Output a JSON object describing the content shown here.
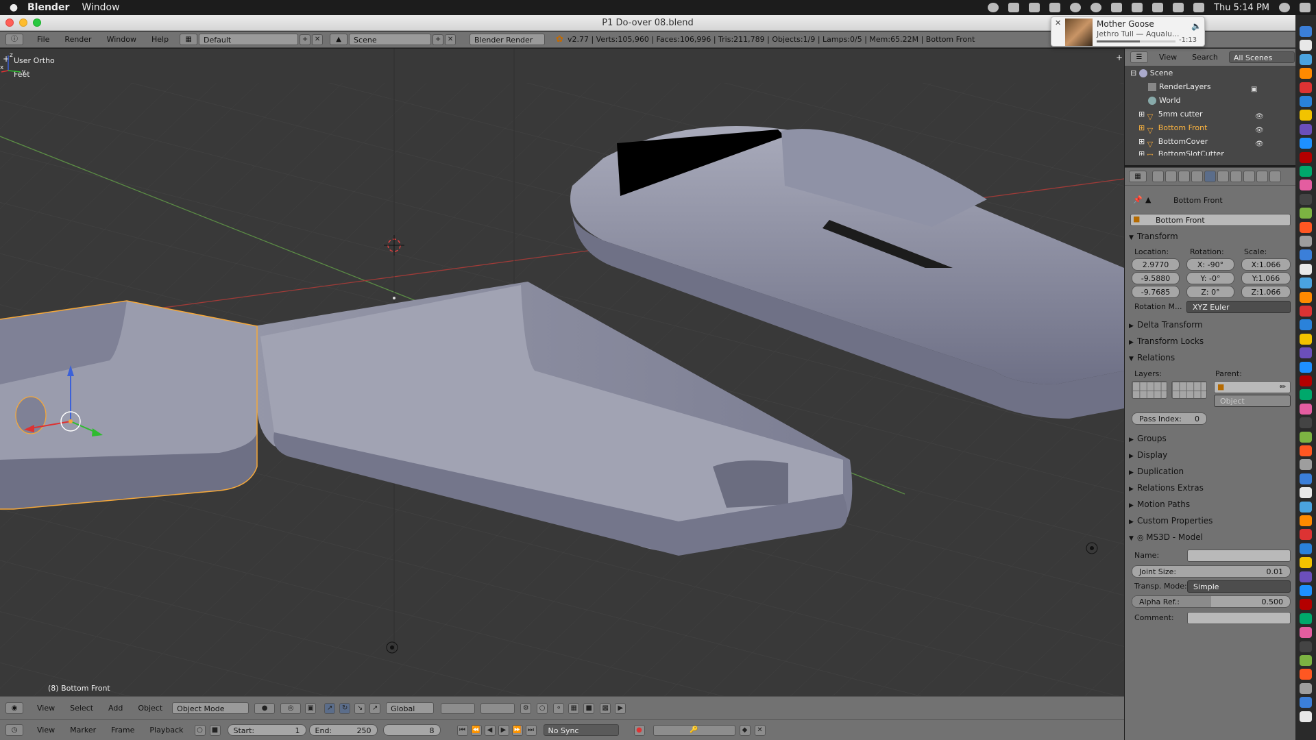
{
  "menubar": {
    "app_name": "Blender",
    "menu_window": "Window",
    "clock": "Thu 5:14 PM"
  },
  "window": {
    "title": "P1 Do-over 08.blend"
  },
  "notification": {
    "title": "Mother Goose",
    "subtitle": "Jethro Tull — Aqualu...",
    "time_remaining": "-1:13",
    "progress": 0.55
  },
  "infobar": {
    "menus": [
      "File",
      "Render",
      "Window",
      "Help"
    ],
    "screen_layout": "Default",
    "scene": "Scene",
    "render_engine": "Blender Render",
    "stats": "v2.77 | Verts:105,960 | Faces:106,996 | Tris:211,789 | Objects:1/9 | Lamps:0/5 | Mem:65.22M | Bottom Front"
  },
  "viewport": {
    "view_name": "User Ortho",
    "units": "Feet",
    "active_object_label": "(8) Bottom Front",
    "axis_x": "x",
    "axis_y": "y",
    "axis_z": "z"
  },
  "viewport_header": {
    "menus": [
      "View",
      "Select",
      "Add",
      "Object"
    ],
    "mode": "Object Mode",
    "orientation": "Global"
  },
  "timeline": {
    "menus": [
      "View",
      "Marker",
      "Frame",
      "Playback"
    ],
    "start_label": "Start:",
    "start_value": "1",
    "end_label": "End:",
    "end_value": "250",
    "current_frame": "8",
    "sync": "No Sync"
  },
  "outliner": {
    "menus": [
      "View",
      "Search"
    ],
    "filter": "All Scenes",
    "items": [
      {
        "label": "Scene"
      },
      {
        "label": "RenderLayers"
      },
      {
        "label": "World"
      },
      {
        "label": "5mm cutter"
      },
      {
        "label": "Bottom Front"
      },
      {
        "label": "BottomCover"
      },
      {
        "label": "BottomSlotCutter"
      }
    ]
  },
  "properties": {
    "breadcrumb": "Bottom Front",
    "object_name": "Bottom Front",
    "transform": {
      "title": "Transform",
      "location_label": "Location:",
      "rotation_label": "Rotation:",
      "scale_label": "Scale:",
      "location": [
        "2.9770",
        "-9.5880",
        "-9.7685"
      ],
      "rotation": [
        "X:  -90°",
        "Y:   -0°",
        "Z:    0°"
      ],
      "scale": [
        "X:1.066",
        "Y:1.066",
        "Z:1.066"
      ],
      "rotation_mode_label": "Rotation M...",
      "rotation_mode": "XYZ Euler"
    },
    "delta_transform": "Delta Transform",
    "transform_locks": "Transform Locks",
    "relations": {
      "title": "Relations",
      "layers_label": "Layers:",
      "parent_label": "Parent:",
      "parent_type": "Object",
      "pass_index_label": "Pass Index:",
      "pass_index": "0"
    },
    "collapsed_panels": [
      "Groups",
      "Display",
      "Duplication",
      "Relations Extras",
      "Motion Paths",
      "Custom Properties"
    ],
    "ms3d": {
      "title": "MS3D - Model",
      "name_label": "Name:",
      "joint_size_label": "Joint Size:",
      "joint_size": "0.01",
      "transp_mode_label": "Transp. Mode:",
      "transp_mode": "Simple",
      "alpha_ref_label": "Alpha Ref.:",
      "alpha_ref": "0.500",
      "alpha_ref_value": 0.5,
      "comment_label": "Comment:"
    }
  },
  "colors": {
    "viewport_bg": "#393939",
    "selection_outline": "#f5a83a",
    "x_axis": "#c8453f",
    "y_axis": "#6aa54b",
    "mesh": "#8c8fa3"
  }
}
